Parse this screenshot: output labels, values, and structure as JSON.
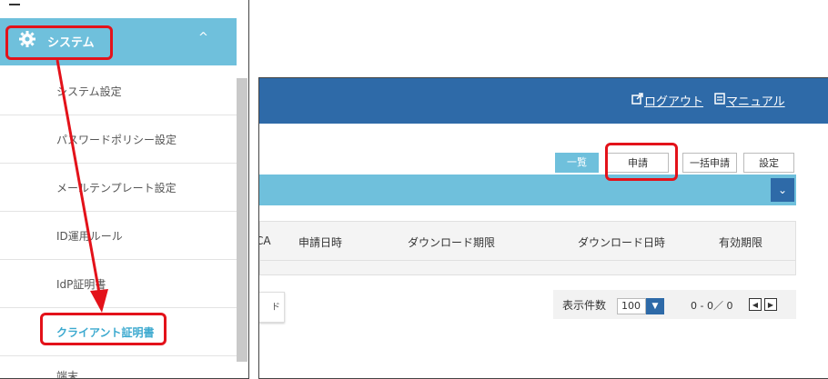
{
  "sidebar": {
    "system_label": "システム",
    "chevron": "^",
    "items": [
      {
        "label": "システム設定",
        "active": false
      },
      {
        "label": "パスワードポリシー設定",
        "active": false
      },
      {
        "label": "メールテンプレート設定",
        "active": false
      },
      {
        "label": "ID運用ルール",
        "active": false
      },
      {
        "label": "IdP証明書",
        "active": false
      },
      {
        "label": "クライアント証明書",
        "active": true
      }
    ],
    "truncated_item": "端末"
  },
  "header": {
    "logout_label": "ログアウト",
    "manual_label": "マニュアル"
  },
  "tabs": {
    "list_label": "一覧",
    "apply_label": "申請",
    "bulk_label": "一括申請",
    "settings_label": "設定"
  },
  "filter": {
    "toggle_icon": "chevron-down"
  },
  "table": {
    "columns": [
      "CA",
      "申請日時",
      "ダウンロード期限",
      "ダウンロード日時",
      "有効期限"
    ]
  },
  "download_button_fragment": "ド",
  "pagination": {
    "per_page_label": "表示件数",
    "per_page_value": "100",
    "range_text": "0 - 0／ 0"
  },
  "colors": {
    "accent": "#6fc0dc",
    "header": "#2e6aa8",
    "annotation": "#e3121a"
  }
}
